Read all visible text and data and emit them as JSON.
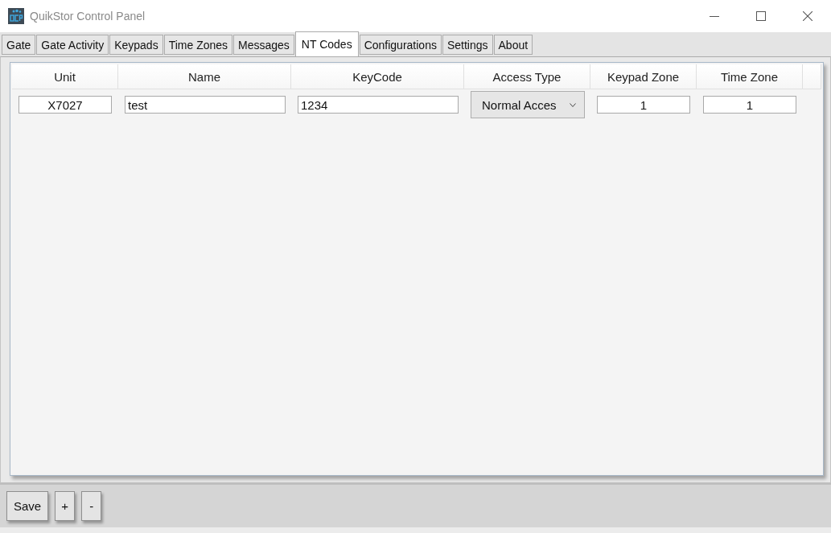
{
  "window": {
    "title": "QuikStor Control Panel"
  },
  "tabs": [
    {
      "label": "Gate",
      "selected": false
    },
    {
      "label": "Gate Activity",
      "selected": false
    },
    {
      "label": "Keypads",
      "selected": false
    },
    {
      "label": "Time Zones",
      "selected": false
    },
    {
      "label": "Messages",
      "selected": false
    },
    {
      "label": "NT Codes",
      "selected": true
    },
    {
      "label": "Configurations",
      "selected": false
    },
    {
      "label": "Settings",
      "selected": false
    },
    {
      "label": "About",
      "selected": false
    }
  ],
  "table": {
    "columns": [
      "Unit",
      "Name",
      "KeyCode",
      "Access Type",
      "Keypad Zone",
      "Time Zone"
    ],
    "rows": [
      {
        "cells": [
          {
            "kind": "field",
            "value": "X7027"
          },
          {
            "kind": "field",
            "value": "test"
          },
          {
            "kind": "field",
            "value": "1234"
          },
          {
            "kind": "dropdown",
            "value": "Normal Acces"
          },
          {
            "kind": "field",
            "value": "1"
          },
          {
            "kind": "field",
            "value": "1"
          }
        ]
      }
    ]
  },
  "buttons": [
    "Save",
    "+",
    "-"
  ]
}
